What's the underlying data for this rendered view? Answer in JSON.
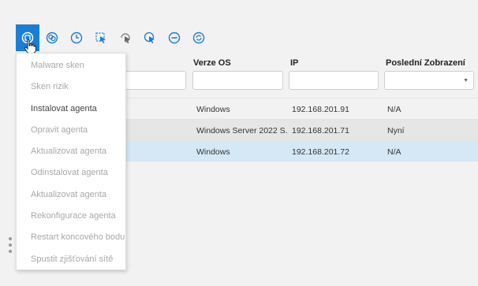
{
  "toolbar": {
    "buttons": [
      {
        "icon": "scan-icon",
        "active": true
      },
      {
        "icon": "risk-icon",
        "active": false
      },
      {
        "icon": "clock-icon",
        "active": false
      },
      {
        "icon": "pointer-icon",
        "active": false
      },
      {
        "icon": "refresh-pointer-icon",
        "active": false
      },
      {
        "icon": "cursor-circle-icon",
        "active": false
      },
      {
        "icon": "minus-icon",
        "active": false
      },
      {
        "icon": "sync-icon",
        "active": false
      }
    ],
    "accent": "#1a7fd4"
  },
  "table": {
    "columns": [
      "Verze OS",
      "IP",
      "Poslední Zobrazení"
    ],
    "rows": [
      {
        "os": "Windows",
        "ip": "192.168.201.91",
        "seen": "N/A",
        "selected": false
      },
      {
        "os": "Windows Server 2022 S...",
        "ip": "192.168.201.71",
        "seen": "Nyní",
        "selected": false
      },
      {
        "os": "Windows",
        "ip": "192.168.201.72",
        "seen": "N/A",
        "selected": true
      }
    ]
  },
  "menu": {
    "items": [
      {
        "label": "Malware sken",
        "enabled": false
      },
      {
        "label": "Sken rizik",
        "enabled": false
      },
      {
        "label": "Instalovat agenta",
        "enabled": true
      },
      {
        "label": "Opravit agenta",
        "enabled": false
      },
      {
        "label": "Aktualizovat agenta",
        "enabled": false
      },
      {
        "label": "Odinstalovat agenta",
        "enabled": false
      },
      {
        "label": "Aktualizovat agenta",
        "enabled": false
      },
      {
        "label": "Rekonfigurace agenta",
        "enabled": false
      },
      {
        "label": "Restart koncového bodu",
        "enabled": false
      },
      {
        "label": "Spustit zjišťování sítě",
        "enabled": false
      }
    ]
  }
}
